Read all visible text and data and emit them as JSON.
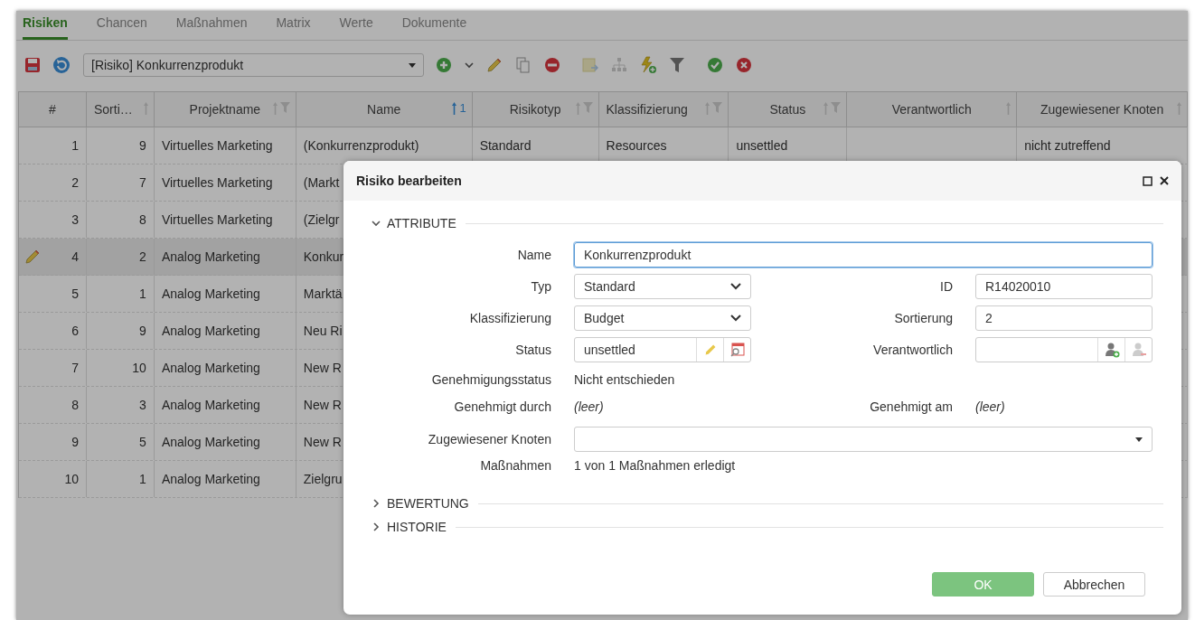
{
  "tabs": [
    {
      "label": "Risiken",
      "selected": true
    },
    {
      "label": "Chancen",
      "selected": false
    },
    {
      "label": "Maßnahmen",
      "selected": false
    },
    {
      "label": "Matrix",
      "selected": false
    },
    {
      "label": "Werte",
      "selected": false
    },
    {
      "label": "Dokumente",
      "selected": false
    }
  ],
  "toolbar": {
    "selector": "[Risiko] Konkurrenzprodukt"
  },
  "table": {
    "columns": [
      {
        "label": "#",
        "sortable": false,
        "filter": false
      },
      {
        "label": "Sorti…",
        "sortable": true,
        "filter": false
      },
      {
        "label": "Projektname",
        "sortable": true,
        "filter": true
      },
      {
        "label": "Name",
        "sortable": true,
        "filter": false,
        "sort_rank": "1"
      },
      {
        "label": "Risikotyp",
        "sortable": true,
        "filter": true
      },
      {
        "label": "Klassifizierung",
        "sortable": true,
        "filter": true
      },
      {
        "label": "Status",
        "sortable": true,
        "filter": true
      },
      {
        "label": "Verantwortlich",
        "sortable": true,
        "filter": false
      },
      {
        "label": "Zugewiesener Knoten",
        "sortable": true,
        "filter": false
      }
    ],
    "rows": [
      {
        "selected": false,
        "cells": [
          "1",
          "9",
          "Virtuelles Marketing",
          "(Konkurrenzprodukt)",
          "Standard",
          "Resources",
          "unsettled",
          null,
          "nicht zutreffend"
        ]
      },
      {
        "selected": false,
        "cells": [
          "2",
          "7",
          "Virtuelles Marketing",
          "(Markt"
        ]
      },
      {
        "selected": false,
        "cells": [
          "3",
          "8",
          "Virtuelles Marketing",
          "(Zielgr"
        ]
      },
      {
        "selected": true,
        "cells": [
          "4",
          "2",
          "Analog Marketing",
          "Konkur"
        ]
      },
      {
        "selected": false,
        "cells": [
          "5",
          "1",
          "Analog Marketing",
          "Marktä"
        ]
      },
      {
        "selected": false,
        "cells": [
          "6",
          "9",
          "Analog Marketing",
          "Neu Ri"
        ]
      },
      {
        "selected": false,
        "cells": [
          "7",
          "10",
          "Analog Marketing",
          "New R"
        ]
      },
      {
        "selected": false,
        "cells": [
          "8",
          "3",
          "Analog Marketing",
          "New R"
        ]
      },
      {
        "selected": false,
        "cells": [
          "9",
          "5",
          "Analog Marketing",
          "New R"
        ]
      },
      {
        "selected": false,
        "cells": [
          "10",
          "1",
          "Analog Marketing",
          "Zielgru"
        ]
      }
    ]
  },
  "dialog": {
    "title": "Risiko bearbeiten",
    "sections": [
      {
        "title": "ATTRIBUTE",
        "expanded": true,
        "rows": [
          {
            "fields": [
              {
                "label": "Name",
                "kind": "input",
                "value": "Konkurrenzprodukt",
                "focused": true
              }
            ]
          },
          {
            "fields": [
              {
                "label": "Typ",
                "kind": "select",
                "value": "Standard"
              },
              {
                "label": "ID",
                "kind": "input",
                "value": "R14020010",
                "focused": false
              }
            ]
          },
          {
            "fields": [
              {
                "label": "Klassifizierung",
                "kind": "select",
                "value": "Budget"
              },
              {
                "label": "Sortierung",
                "kind": "input",
                "value": "2",
                "focused": false
              }
            ]
          },
          {
            "fields": [
              {
                "label": "Status",
                "kind": "status",
                "value": "unsettled"
              },
              {
                "label": "Verantwortlich",
                "kind": "person"
              }
            ]
          },
          {
            "fields": [
              {
                "label": "Genehmigungsstatus",
                "kind": "static",
                "value": "Nicht entschieden",
                "italic": false
              }
            ]
          },
          {
            "fields": [
              {
                "label": "Genehmigt durch",
                "kind": "static",
                "value": "(leer)",
                "italic": true
              },
              {
                "label": "Genehmigt am",
                "kind": "static",
                "value": "(leer)",
                "italic": true
              }
            ]
          },
          {
            "fields": [
              {
                "label": "Zugewiesener Knoten",
                "kind": "combo"
              }
            ]
          },
          {
            "fields": [
              {
                "label": "Maßnahmen",
                "kind": "static",
                "value": "1 von 1 Maßnahmen erledigt",
                "italic": false
              }
            ]
          }
        ]
      },
      {
        "title": "BEWERTUNG",
        "expanded": false
      },
      {
        "title": "HISTORIE",
        "expanded": false
      }
    ],
    "buttons": [
      {
        "label": "OK",
        "kind": "primary"
      },
      {
        "label": "Abbrechen",
        "kind": "secondary"
      }
    ]
  }
}
